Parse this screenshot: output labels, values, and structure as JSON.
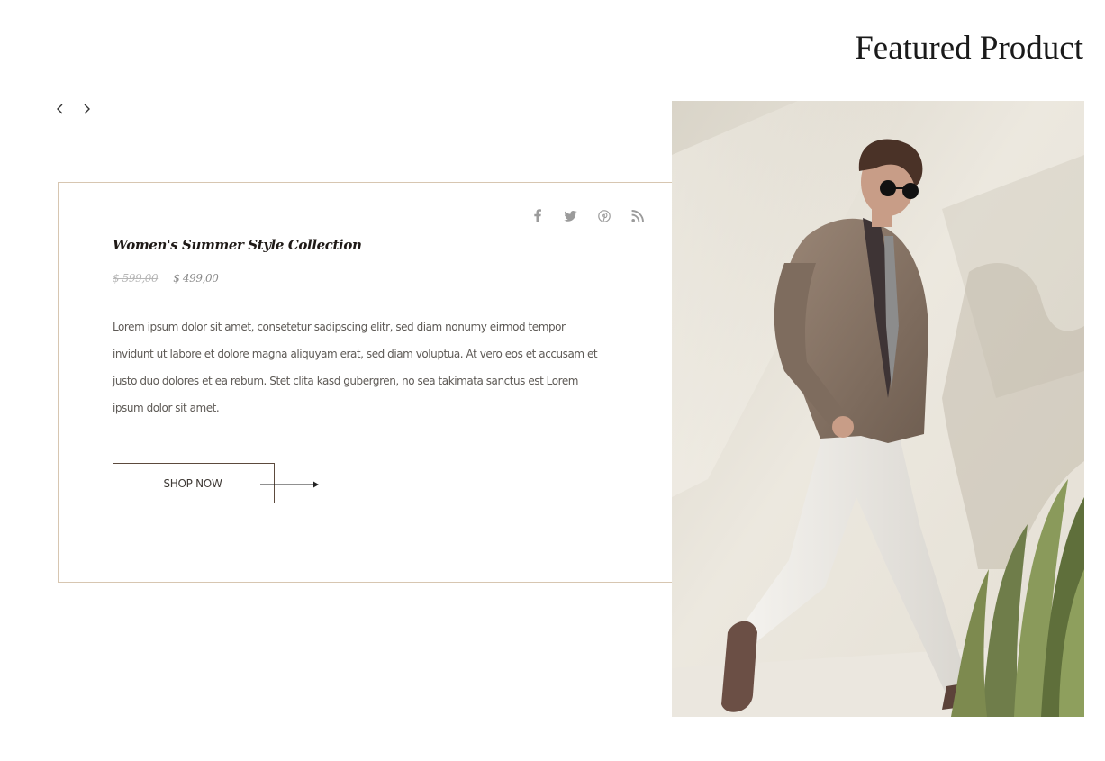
{
  "section": {
    "title": "Featured Product"
  },
  "slider": {
    "prev_icon": "chevron-left-icon",
    "next_icon": "chevron-right-icon"
  },
  "product": {
    "title": "Women's Summer Style Collection",
    "old_price": "$ 599,00",
    "new_price": "$ 499,00",
    "description": "Lorem ipsum dolor sit amet, consetetur sadipscing elitr, sed diam nonumy eirmod tempor invidunt ut labore et dolore magna aliquyam erat, sed diam voluptua. At vero eos et accusam et justo duo dolores et ea rebum. Stet clita kasd gubergren, no sea takimata sanctus est Lorem ipsum dolor sit amet.",
    "cta_label": "SHOP NOW"
  },
  "social": [
    {
      "icon": "facebook-icon"
    },
    {
      "icon": "twitter-icon"
    },
    {
      "icon": "pinterest-icon"
    },
    {
      "icon": "rss-icon"
    }
  ],
  "colors": {
    "card_border": "#d7c6b1",
    "button_border": "#5c4a3d",
    "icon_gray": "#9b9b9b",
    "title": "#1f1a17"
  }
}
